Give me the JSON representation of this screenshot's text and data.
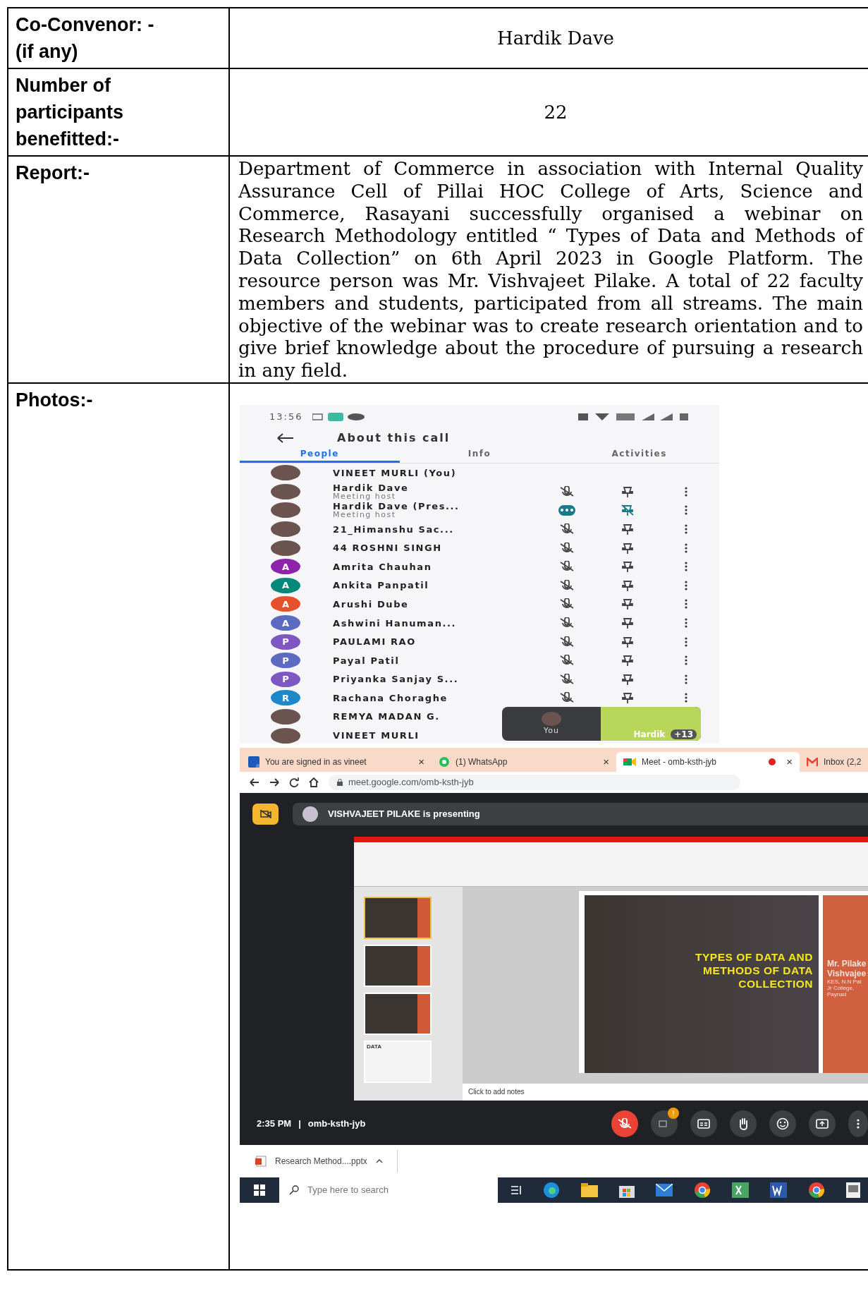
{
  "details": [
    {
      "label_lines": [
        "Co-Convenor: -",
        "(if any)"
      ],
      "value": "Hardik Dave"
    },
    {
      "label_lines": [
        "Number of",
        "participants",
        "benefitted:-"
      ],
      "value": "22"
    }
  ],
  "report": {
    "label": "Report:-",
    "text": "Department of Commerce in association with Internal Quality Assurance Cell of Pillai HOC College of Arts, Science and Commerce, Rasayani successfully organised a webinar on Research Methodology entitled “  Types of Data and Methods of Data Collection” on 6th April  2023 in Google Platform. The resource person was Mr. Vishvajeet Pilake.  A total of 22 faculty members and students, participated from all streams. The main objective of the webinar was to create research orientation and to give brief knowledge about the procedure of pursuing a research in any field."
  },
  "photos": {
    "label": "Photos:-",
    "phone": {
      "status_time": "13:56",
      "title": "About this call",
      "tabs": [
        {
          "label": "People",
          "selected": true
        },
        {
          "label": "Info",
          "selected": false
        },
        {
          "label": "Activities",
          "selected": false
        }
      ],
      "participants": [
        {
          "kind": "self",
          "name": "VINEET MURLI (You)",
          "avatar": {
            "kind": "photo"
          }
        },
        {
          "kind": "member",
          "name": "Hardik Dave",
          "subtitle": "Meeting host",
          "avatar": {
            "kind": "photo"
          },
          "presenting": false,
          "pinned": false
        },
        {
          "kind": "member",
          "name": "Hardik Dave (Pres...",
          "subtitle": "Meeting host",
          "avatar": {
            "kind": "photo"
          },
          "presenting": true,
          "pinned": true
        },
        {
          "kind": "member",
          "name": "21_Himanshu Sac...",
          "avatar": {
            "kind": "photo"
          },
          "presenting": false,
          "pinned": false
        },
        {
          "kind": "member",
          "name": "44 ROSHNI SINGH",
          "avatar": {
            "kind": "photo"
          },
          "presenting": false,
          "pinned": false
        },
        {
          "kind": "member",
          "name": "Amrita Chauhan",
          "avatar": {
            "kind": "letter",
            "letter": "A",
            "color": "#8e24aa"
          },
          "presenting": false,
          "pinned": false
        },
        {
          "kind": "member",
          "name": "Ankita Panpatil",
          "avatar": {
            "kind": "letter",
            "letter": "A",
            "color": "#00897b"
          },
          "presenting": false,
          "pinned": false
        },
        {
          "kind": "member",
          "name": "Arushi Dube",
          "avatar": {
            "kind": "letter",
            "letter": "A",
            "color": "#e6512b"
          },
          "presenting": false,
          "pinned": false
        },
        {
          "kind": "member",
          "name": "Ashwini Hanuman...",
          "avatar": {
            "kind": "letter",
            "letter": "A",
            "color": "#5c6bc0"
          },
          "presenting": false,
          "pinned": false
        },
        {
          "kind": "member",
          "name": "PAULAMI RAO",
          "avatar": {
            "kind": "letter",
            "letter": "P",
            "color": "#7e57c2"
          },
          "presenting": false,
          "pinned": false
        },
        {
          "kind": "member",
          "name": "Payal Patil",
          "avatar": {
            "kind": "letter",
            "letter": "P",
            "color": "#5c6bc0"
          },
          "presenting": false,
          "pinned": false
        },
        {
          "kind": "member",
          "name": "Priyanka Sanjay S...",
          "avatar": {
            "kind": "letter",
            "letter": "P",
            "color": "#7e57c2"
          },
          "presenting": false,
          "pinned": false
        },
        {
          "kind": "member",
          "name": "Rachana Choraghe",
          "avatar": {
            "kind": "letter",
            "letter": "R",
            "color": "#1e88c9"
          },
          "presenting": false,
          "pinned": false
        },
        {
          "kind": "covered",
          "name": "REMYA MADAN G.",
          "avatar": {
            "kind": "photo"
          }
        },
        {
          "kind": "covered",
          "name": "VINEET MURLI",
          "avatar": {
            "kind": "photo"
          }
        }
      ],
      "tile": {
        "self_label": "You",
        "other_label": "Hardik",
        "count": "+13"
      }
    },
    "desktop": {
      "tabs": [
        {
          "kind": "site",
          "title": "You are signed in as vineet",
          "close": "×",
          "selected": false
        },
        {
          "kind": "whatsapp",
          "title": "(1) WhatsApp",
          "close": "×",
          "selected": false
        },
        {
          "kind": "meet",
          "title": "Meet - omb-ksth-jyb",
          "close": "×",
          "recording": true,
          "selected": true
        },
        {
          "kind": "gmail",
          "title": "Inbox (2,2",
          "selected": false
        }
      ],
      "address": "meet.google.com/omb-ksth-jyb",
      "presenter_banner": "VISHVAJEET PILAKE is presenting",
      "slides": {
        "thumbnail_label": "DATA",
        "title": "TYPES OF DATA AND METHODS OF DATA COLLECTION",
        "presenter_lines": [
          "Mr. Pilake",
          "Vishvajee"
        ],
        "presenter_details": [
          "KES, N.N Pat",
          "Jr College,",
          "Paynad"
        ],
        "notes_placeholder": "Click to add notes"
      },
      "time": "2:35 PM",
      "separator": "|",
      "meeting_code": "omb-ksth-jyb",
      "mic_muted": true,
      "badge": "!",
      "download": "Research Method....pptx",
      "taskbar_search": {
        "placeholder": "Type here to search"
      }
    }
  }
}
